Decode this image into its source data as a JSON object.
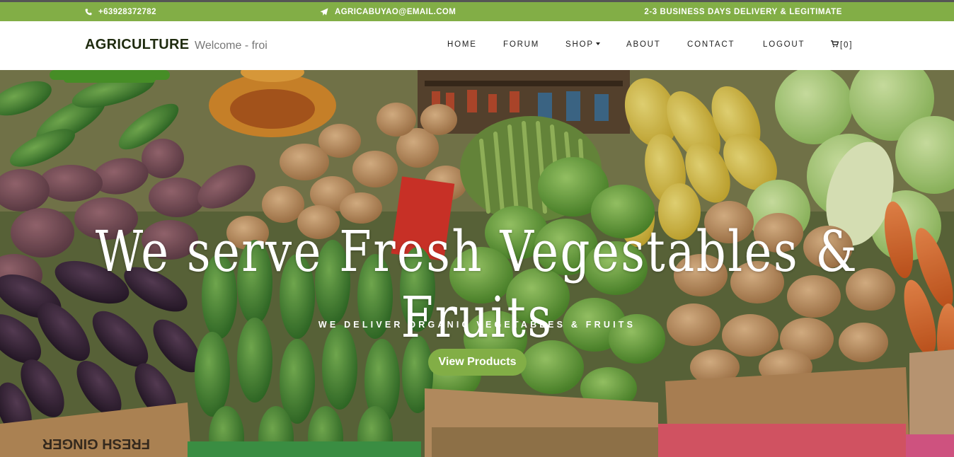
{
  "topbar": {
    "phone": "+63928372782",
    "email": "AGRICABUYAO@EMAIL.COM",
    "delivery": "2-3 BUSINESS DAYS DELIVERY & LEGITIMATE",
    "phone_icon": "phone-icon",
    "email_icon": "paper-plane-icon",
    "accent_color": "#82ae46"
  },
  "navbar": {
    "brand": "AGRICULTURE",
    "welcome": "Welcome - froi",
    "links": [
      "HOME",
      "FORUM",
      "SHOP",
      "ABOUT",
      "CONTACT",
      "LOGOUT"
    ],
    "cart_icon": "cart-icon",
    "cart_count": "[0]"
  },
  "hero": {
    "title": "We serve Fresh Vegestables & Fruits",
    "subtitle": "WE DELIVER ORGANIC VEGETABLES & FRUITS",
    "button": "View Products",
    "box_text": "FRESH GINGER"
  }
}
